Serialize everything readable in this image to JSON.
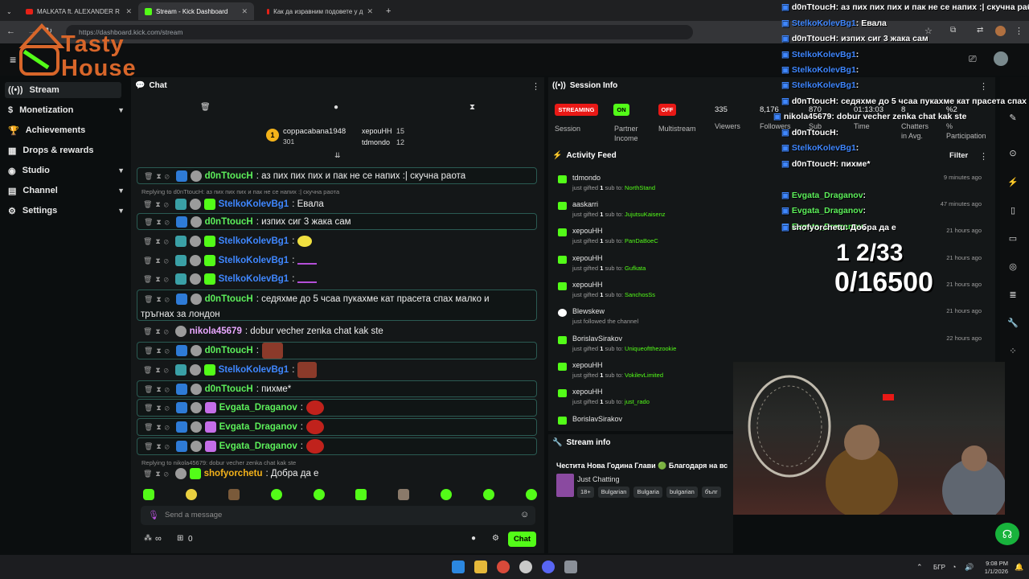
{
  "browser": {
    "tabs": [
      {
        "title": "MALKATA ft. ALEXANDER R"
      },
      {
        "title": "Stream - Kick Dashboard"
      },
      {
        "title": "Как да изравним подовете у д"
      }
    ],
    "url": "https://dashboard.kick.com/stream"
  },
  "logo": {
    "text": "Tasty House"
  },
  "sidebar": {
    "items": [
      {
        "label": "Stream"
      },
      {
        "label": "Monetization"
      },
      {
        "label": "Achievements"
      },
      {
        "label": "Drops & rewards"
      },
      {
        "label": "Studio"
      },
      {
        "label": "Channel"
      },
      {
        "label": "Settings"
      }
    ]
  },
  "chat": {
    "title": "Chat",
    "leaders": [
      {
        "rank": "1",
        "name": "coppacabana1948",
        "count": "301"
      },
      {
        "name": "хepouHH",
        "count": "15"
      },
      {
        "name": "tdmondo",
        "count": "12"
      }
    ],
    "messages": [
      {
        "user": "d0nTtoucH",
        "text": ": аз пих пих пих и пак не се напих :| скучна раота"
      },
      {
        "reply": "Replying to d0nTtoucH: аз пих пих пих и пак не се напих :| скучна раота"
      },
      {
        "user": "StelkoKolevBg1",
        "text": ": Евала"
      },
      {
        "user": "d0nTtoucH",
        "text": ": изпих сиг 3 жака сам"
      },
      {
        "user": "StelkoKolevBg1",
        "text": ":"
      },
      {
        "user": "StelkoKolevBg1",
        "text": ":"
      },
      {
        "user": "StelkoKolevBg1",
        "text": ":"
      },
      {
        "user": "d0nTtoucH",
        "text": ": седяхме до 5 чсаа пукахме кат прасета спах малко и"
      },
      {
        "text": "тръгнах за лондон"
      },
      {
        "user": "nikola45679",
        "text": ": dobur vecher zenka chat kak ste"
      },
      {
        "user": "d0nTtoucH",
        "text": ":"
      },
      {
        "user": "StelkoKolevBg1",
        "text": ":"
      },
      {
        "user": "d0nTtoucH",
        "text": ": пихме*"
      },
      {
        "user": "Evgata_Draganov",
        "text": ":"
      },
      {
        "user": "Evgata_Draganov",
        "text": ":"
      },
      {
        "user": "Evgata_Draganov",
        "text": ":"
      },
      {
        "reply": "Replying to nikola45679: dobur vecher zenka chat kak ste"
      },
      {
        "user": "shofyorchetu",
        "text": ": Добра да е"
      }
    ],
    "input_placeholder": "Send a message",
    "points_label": "∞",
    "count_label": "0",
    "chat_button": "Chat"
  },
  "session": {
    "title": "Session Info",
    "streaming_badge": "STREAMING",
    "on_badge": "ON",
    "off_badge": "OFF",
    "labels": {
      "session": "Session",
      "partner": "Partner",
      "income": "Income",
      "multistream": "Multistream"
    },
    "viewers": "335",
    "viewers_label": "Viewers",
    "followers": "8,176",
    "followers_label": "Followers",
    "subs": "870",
    "subs_label": "Sub",
    "time": "01:13:03",
    "time_label": "Time",
    "chatters": "8",
    "chatters_label": "Chatters",
    "chatters_label2": "in Avg.",
    "participation": "%2",
    "participation_label": "%",
    "participation_label2": "Participation"
  },
  "activity": {
    "title": "Activity Feed",
    "filter": "Filter",
    "items": [
      {
        "name": "tdmondo",
        "pre": "just gifted ",
        "num": "1",
        "mid": " sub to: ",
        "target": "NorthStand",
        "time": "9 minutes ago"
      },
      {
        "name": "aaskarri",
        "pre": "just gifted ",
        "num": "1",
        "mid": " sub to: ",
        "target": "JujutsuKaisenz",
        "time": "47 minutes ago"
      },
      {
        "name": "хepouHH",
        "pre": "just gifted ",
        "num": "1",
        "mid": " sub to: ",
        "target": "PanDaBoeC",
        "time": "21 hours ago"
      },
      {
        "name": "хepouHH",
        "pre": "just gifted ",
        "num": "1",
        "mid": " sub to: ",
        "target": "Gufkata",
        "time": "21 hours ago"
      },
      {
        "name": "хepouHH",
        "pre": "just gifted ",
        "num": "1",
        "mid": " sub to: ",
        "target": "SanchosSs",
        "time": "21 hours ago"
      },
      {
        "name": "Blewskew",
        "pre": "just followed the channel",
        "num": "",
        "mid": "",
        "target": "",
        "time": "21 hours ago"
      },
      {
        "name": "BorislavSirakov",
        "pre": "just gifted ",
        "num": "1",
        "mid": " sub to: ",
        "target": "Uniqueoftthezookie",
        "time": "22 hours ago"
      },
      {
        "name": "хepouHH",
        "pre": "just gifted ",
        "num": "1",
        "mid": " sub to: ",
        "target": "VokilevLimited",
        "time": "21 hours ago"
      },
      {
        "name": "хepouHH",
        "pre": "just gifted ",
        "num": "1",
        "mid": " sub to: ",
        "target": "just_rado",
        "time": "21 hours ago"
      },
      {
        "name": "BorislavSirakov",
        "pre": "",
        "num": "",
        "mid": "",
        "target": "",
        "time": ""
      }
    ]
  },
  "stream_info": {
    "title": "Stream info",
    "stream_title": "Честита Нова Година Глави 🟢 Благодаря на вс",
    "category": "Just Chatting",
    "tags": [
      "18+",
      "Bulgarian",
      "Bulgaria",
      "bulgarian",
      "бълг"
    ]
  },
  "overlay": {
    "messages": [
      {
        "user": "d0nTtoucH",
        "text": ": аз пих пих пих и пак не се напих :| скучна раб"
      },
      {
        "user": "StelkoKolevBg1",
        "text": ": Евала"
      },
      {
        "user": "d0nTtoucH",
        "text": ": изпих сиг 3 жака сам"
      },
      {
        "user": "StelkoKolevBg1",
        "text": ":"
      },
      {
        "user": "StelkoKolevBg1",
        "text": ":"
      },
      {
        "user": "StelkoKolevBg1",
        "text": ":"
      },
      {
        "user": "d0nTtoucH",
        "text": ": седяхме до 5 чсаа пукахме кат прасета спах"
      },
      {
        "user": "nikola45679",
        "text": ": dobur vecher zenka chat kak ste"
      },
      {
        "user": "d0nTtoucH",
        "text": ":"
      },
      {
        "user": "StelkoKolevBg1",
        "text": ":"
      },
      {
        "user": "d0nTtoucH",
        "text": ": пихме*"
      },
      {
        "user": "Evgata_Draganov",
        "text": ":"
      },
      {
        "user": "Evgata_Draganov",
        "text": ":"
      },
      {
        "user": "Evgata_Draganov",
        "text": ":"
      },
      {
        "user": "shofyorchetu",
        "text": ": Добра да е"
      }
    ],
    "counter1": "1 2/33",
    "counter2": "0/16500"
  },
  "taskbar": {
    "lang": "БГР",
    "time": "9:08 PM",
    "date": "1/1/2026"
  },
  "colors": {
    "accent": "#53fc18",
    "blue_user": "#3f87ff",
    "purple_user": "#e9a7ff",
    "red_badge": "#e91916"
  }
}
